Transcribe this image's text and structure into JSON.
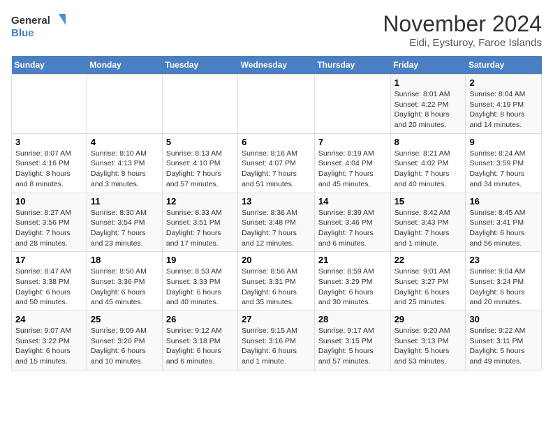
{
  "logo": {
    "line1": "General",
    "line2": "Blue"
  },
  "title": "November 2024",
  "subtitle": "Eidi, Eysturoy, Faroe Islands",
  "weekdays": [
    "Sunday",
    "Monday",
    "Tuesday",
    "Wednesday",
    "Thursday",
    "Friday",
    "Saturday"
  ],
  "weeks": [
    [
      {
        "day": "",
        "info": ""
      },
      {
        "day": "",
        "info": ""
      },
      {
        "day": "",
        "info": ""
      },
      {
        "day": "",
        "info": ""
      },
      {
        "day": "",
        "info": ""
      },
      {
        "day": "1",
        "info": "Sunrise: 8:01 AM\nSunset: 4:22 PM\nDaylight: 8 hours and 20 minutes."
      },
      {
        "day": "2",
        "info": "Sunrise: 8:04 AM\nSunset: 4:19 PM\nDaylight: 8 hours and 14 minutes."
      }
    ],
    [
      {
        "day": "3",
        "info": "Sunrise: 8:07 AM\nSunset: 4:16 PM\nDaylight: 8 hours and 8 minutes."
      },
      {
        "day": "4",
        "info": "Sunrise: 8:10 AM\nSunset: 4:13 PM\nDaylight: 8 hours and 3 minutes."
      },
      {
        "day": "5",
        "info": "Sunrise: 8:13 AM\nSunset: 4:10 PM\nDaylight: 7 hours and 57 minutes."
      },
      {
        "day": "6",
        "info": "Sunrise: 8:16 AM\nSunset: 4:07 PM\nDaylight: 7 hours and 51 minutes."
      },
      {
        "day": "7",
        "info": "Sunrise: 8:19 AM\nSunset: 4:04 PM\nDaylight: 7 hours and 45 minutes."
      },
      {
        "day": "8",
        "info": "Sunrise: 8:21 AM\nSunset: 4:02 PM\nDaylight: 7 hours and 40 minutes."
      },
      {
        "day": "9",
        "info": "Sunrise: 8:24 AM\nSunset: 3:59 PM\nDaylight: 7 hours and 34 minutes."
      }
    ],
    [
      {
        "day": "10",
        "info": "Sunrise: 8:27 AM\nSunset: 3:56 PM\nDaylight: 7 hours and 28 minutes."
      },
      {
        "day": "11",
        "info": "Sunrise: 8:30 AM\nSunset: 3:54 PM\nDaylight: 7 hours and 23 minutes."
      },
      {
        "day": "12",
        "info": "Sunrise: 8:33 AM\nSunset: 3:51 PM\nDaylight: 7 hours and 17 minutes."
      },
      {
        "day": "13",
        "info": "Sunrise: 8:36 AM\nSunset: 3:48 PM\nDaylight: 7 hours and 12 minutes."
      },
      {
        "day": "14",
        "info": "Sunrise: 8:39 AM\nSunset: 3:46 PM\nDaylight: 7 hours and 6 minutes."
      },
      {
        "day": "15",
        "info": "Sunrise: 8:42 AM\nSunset: 3:43 PM\nDaylight: 7 hours and 1 minute."
      },
      {
        "day": "16",
        "info": "Sunrise: 8:45 AM\nSunset: 3:41 PM\nDaylight: 6 hours and 56 minutes."
      }
    ],
    [
      {
        "day": "17",
        "info": "Sunrise: 8:47 AM\nSunset: 3:38 PM\nDaylight: 6 hours and 50 minutes."
      },
      {
        "day": "18",
        "info": "Sunrise: 8:50 AM\nSunset: 3:36 PM\nDaylight: 6 hours and 45 minutes."
      },
      {
        "day": "19",
        "info": "Sunrise: 8:53 AM\nSunset: 3:33 PM\nDaylight: 6 hours and 40 minutes."
      },
      {
        "day": "20",
        "info": "Sunrise: 8:56 AM\nSunset: 3:31 PM\nDaylight: 6 hours and 35 minutes."
      },
      {
        "day": "21",
        "info": "Sunrise: 8:59 AM\nSunset: 3:29 PM\nDaylight: 6 hours and 30 minutes."
      },
      {
        "day": "22",
        "info": "Sunrise: 9:01 AM\nSunset: 3:27 PM\nDaylight: 6 hours and 25 minutes."
      },
      {
        "day": "23",
        "info": "Sunrise: 9:04 AM\nSunset: 3:24 PM\nDaylight: 6 hours and 20 minutes."
      }
    ],
    [
      {
        "day": "24",
        "info": "Sunrise: 9:07 AM\nSunset: 3:22 PM\nDaylight: 6 hours and 15 minutes."
      },
      {
        "day": "25",
        "info": "Sunrise: 9:09 AM\nSunset: 3:20 PM\nDaylight: 6 hours and 10 minutes."
      },
      {
        "day": "26",
        "info": "Sunrise: 9:12 AM\nSunset: 3:18 PM\nDaylight: 6 hours and 6 minutes."
      },
      {
        "day": "27",
        "info": "Sunrise: 9:15 AM\nSunset: 3:16 PM\nDaylight: 6 hours and 1 minute."
      },
      {
        "day": "28",
        "info": "Sunrise: 9:17 AM\nSunset: 3:15 PM\nDaylight: 5 hours and 57 minutes."
      },
      {
        "day": "29",
        "info": "Sunrise: 9:20 AM\nSunset: 3:13 PM\nDaylight: 5 hours and 53 minutes."
      },
      {
        "day": "30",
        "info": "Sunrise: 9:22 AM\nSunset: 3:11 PM\nDaylight: 5 hours and 49 minutes."
      }
    ]
  ]
}
